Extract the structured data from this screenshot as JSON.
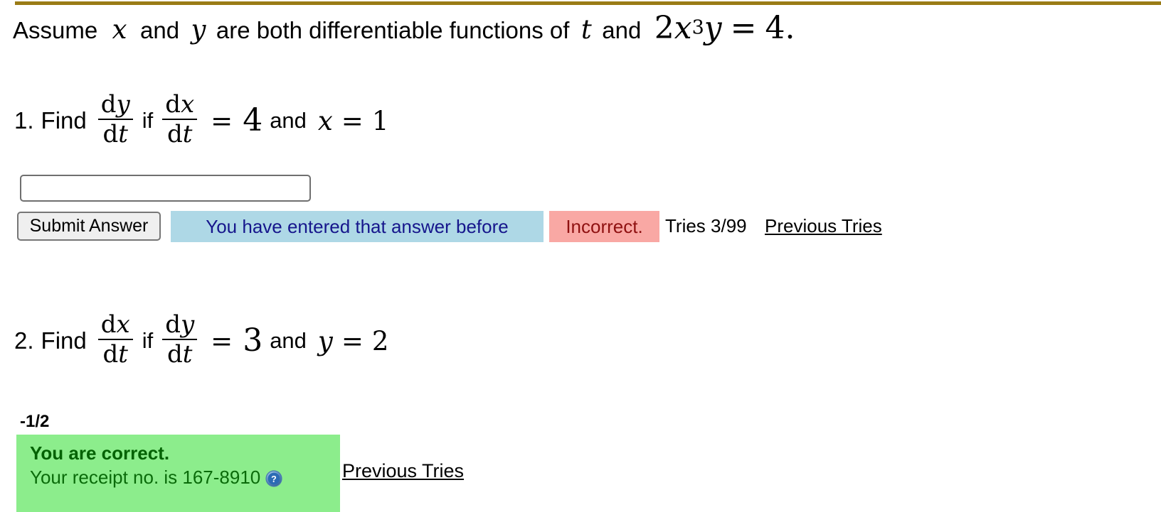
{
  "theme": {
    "top_rule_color": "#9a7b16",
    "info_badge_bg": "#aed8e6",
    "info_badge_fg": "#16168c",
    "error_badge_bg": "#f9a8a4",
    "error_badge_fg": "#8f1111",
    "success_box_bg": "#8ced8c",
    "success_box_fg": "#036203",
    "page_bg": "#ffffff"
  },
  "statement": {
    "lead": "Assume",
    "var_x": "x",
    "and_1": "and",
    "var_y": "y",
    "middle": "are both differentiable functions of",
    "var_t": "t",
    "and_2": "and",
    "equation_coeff": "2",
    "equation_base": "x",
    "equation_power": "3",
    "equation_var2": "y",
    "equation_equals": "=",
    "equation_value": "4",
    "equation_period": "."
  },
  "problems": [
    {
      "number": "1.",
      "find_word": "Find",
      "target_numerator": "d",
      "target_numerator_var": "y",
      "target_denominator": "d",
      "target_denominator_var": "t",
      "if_word": "if",
      "given_numerator": "d",
      "given_numerator_var": "x",
      "given_denominator": "d",
      "given_denominator_var": "t",
      "equals": "=",
      "given_value": "4",
      "and_word": "and",
      "cond_var": "x",
      "cond_equals": "=",
      "cond_value": "1"
    },
    {
      "number": "2.",
      "find_word": "Find",
      "target_numerator": "d",
      "target_numerator_var": "x",
      "target_denominator": "d",
      "target_denominator_var": "t",
      "if_word": "if",
      "given_numerator": "d",
      "given_numerator_var": "y",
      "given_denominator": "d",
      "given_denominator_var": "t",
      "equals": "=",
      "given_value": "3",
      "and_word": "and",
      "cond_var": "y",
      "cond_equals": "=",
      "cond_value": "2"
    }
  ],
  "answer_1": {
    "input_value": "",
    "input_placeholder": "",
    "submit_label": "Submit Answer",
    "duplicate_message": "You have entered that answer before",
    "status_label": "Incorrect.",
    "tries_label": "Tries 3/99",
    "previous_tries_label": "Previous Tries"
  },
  "answer_2": {
    "value": "-1/2",
    "correct_heading": "You are correct.",
    "receipt_text": "Your receipt no. is 167-8910",
    "help_icon_name": "help-icon",
    "previous_tries_label": "Previous Tries"
  }
}
